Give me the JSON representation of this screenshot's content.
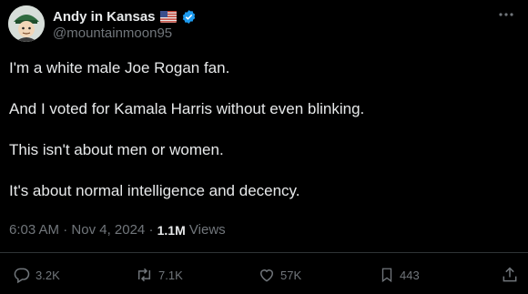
{
  "author": {
    "display_name": "Andy in Kansas",
    "handle": "@mountainmoon95",
    "flag_icon": "us-flag-icon",
    "verified_color": "#1d9bf0"
  },
  "tweet": {
    "paragraphs": [
      "I'm a white male Joe Rogan fan.",
      "And I voted for Kamala Harris without even blinking.",
      "This isn't about men or women.",
      "It's about normal intelligence and decency."
    ],
    "time": "6:03 AM",
    "date": "Nov 4, 2024",
    "separator": " · ",
    "views_count": "1.1M",
    "views_label": "Views"
  },
  "actions": {
    "replies": "3.2K",
    "reposts": "7.1K",
    "likes": "57K",
    "bookmarks": "443"
  },
  "colors": {
    "background": "#000000",
    "text": "#e7e9ea",
    "muted": "#71767b",
    "divider": "#2f3336"
  }
}
